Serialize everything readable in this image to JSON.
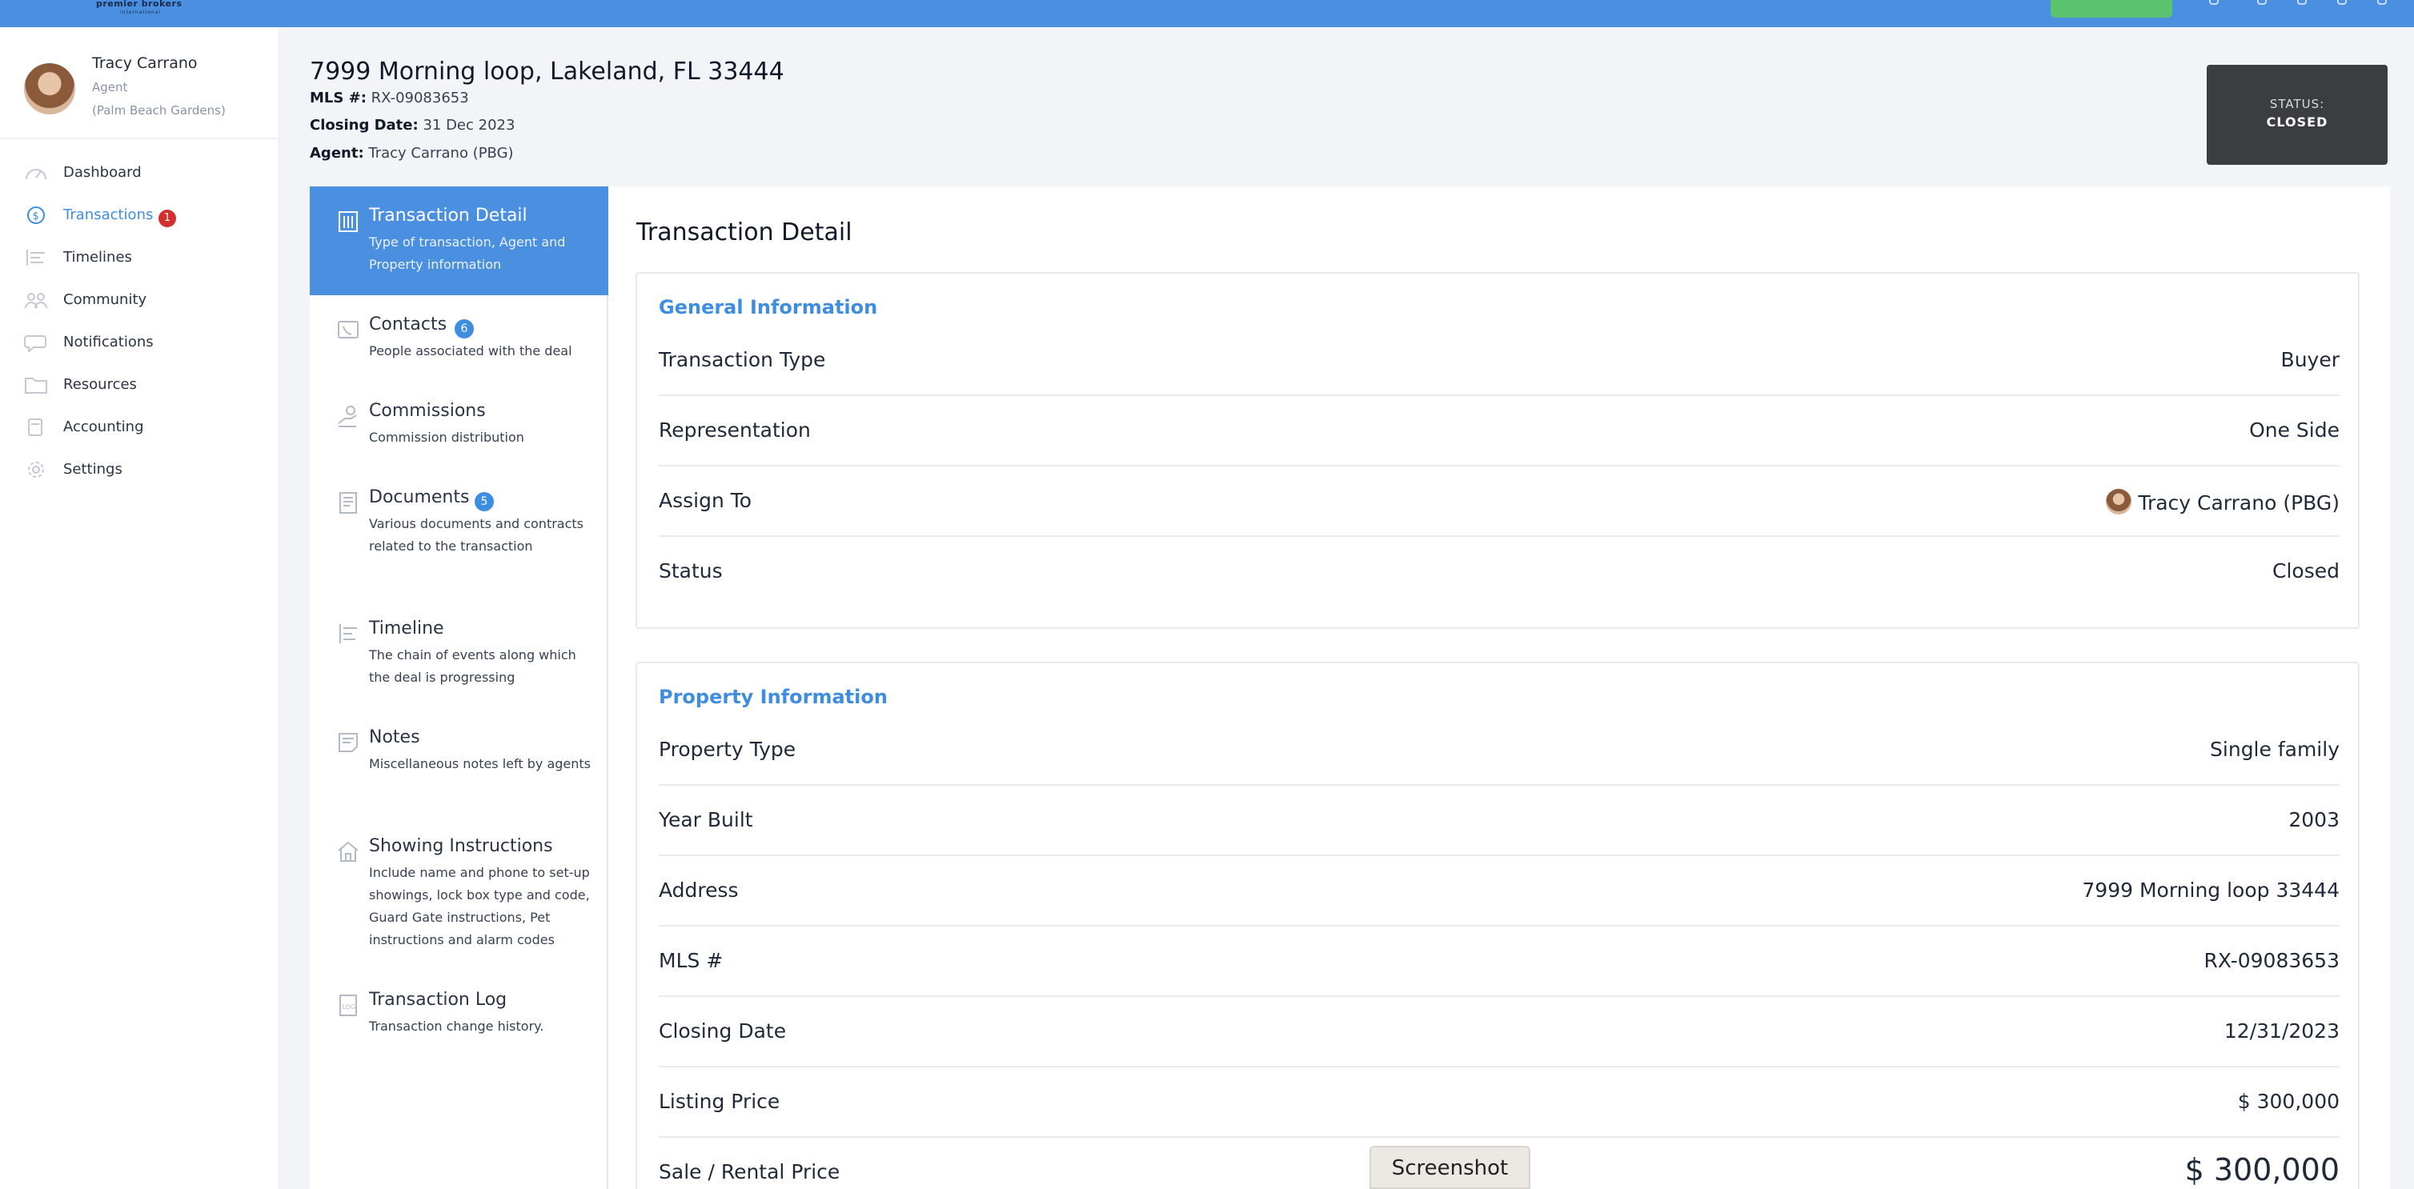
{
  "topbar": {
    "logo_line1": "premier brokers",
    "logo_line2": "international"
  },
  "user": {
    "name": "Tracy Carrano",
    "role": "Agent",
    "office": "(Palm Beach Gardens)"
  },
  "nav": {
    "items": [
      {
        "label": "Dashboard",
        "icon": "speedometer-icon"
      },
      {
        "label": "Transactions",
        "icon": "dollar-cycle-icon",
        "badge": "1",
        "active": true
      },
      {
        "label": "Timelines",
        "icon": "timeline-icon"
      },
      {
        "label": "Community",
        "icon": "people-icon"
      },
      {
        "label": "Notifications",
        "icon": "chat-bubble-icon"
      },
      {
        "label": "Resources",
        "icon": "folder-icon"
      },
      {
        "label": "Accounting",
        "icon": "calculator-icon"
      },
      {
        "label": "Settings",
        "icon": "gear-icon"
      }
    ]
  },
  "header": {
    "address": "7999 Morning loop, Lakeland, FL 33444",
    "mls_label": "MLS #:",
    "mls_value": "RX-09083653",
    "closing_label": "Closing Date:",
    "closing_value": "31 Dec 2023",
    "agent_label": "Agent:",
    "agent_value": "Tracy Carrano (PBG)",
    "status_label": "STATUS:",
    "status_value": "CLOSED"
  },
  "tabs": [
    {
      "title": "Transaction Detail",
      "desc": "Type of transaction, Agent and Property information",
      "icon": "building-icon",
      "active": true
    },
    {
      "title": "Contacts",
      "desc": "People associated with the deal",
      "icon": "phone-icon",
      "badge": "6"
    },
    {
      "title": "Commissions",
      "desc": "Commission distribution",
      "icon": "hand-money-icon"
    },
    {
      "title": "Documents",
      "desc": "Various documents and contracts related to the transaction",
      "icon": "document-icon",
      "badge": "5"
    },
    {
      "title": "Timeline",
      "desc": "The chain of events along which the deal is progressing",
      "icon": "timeline-icon"
    },
    {
      "title": "Notes",
      "desc": "Miscellaneous notes left by agents",
      "icon": "note-icon"
    },
    {
      "title": "Showing Instructions",
      "desc": "Include name and phone to set-up showings, lock box type and code, Guard Gate instructions, Pet instructions and alarm codes",
      "icon": "house-icon"
    },
    {
      "title": "Transaction Log",
      "desc": "Transaction change history.",
      "icon": "log-icon"
    }
  ],
  "main": {
    "title": "Transaction Detail",
    "general": {
      "title": "General Information",
      "rows": [
        {
          "label": "Transaction Type",
          "value": "Buyer"
        },
        {
          "label": "Representation",
          "value": "One Side"
        },
        {
          "label": "Assign To",
          "value": "Tracy Carrano (PBG)"
        },
        {
          "label": "Status",
          "value": "Closed"
        }
      ]
    },
    "property": {
      "title": "Property Information",
      "rows": [
        {
          "label": "Property Type",
          "value": "Single family"
        },
        {
          "label": "Year Built",
          "value": "2003"
        },
        {
          "label": "Address",
          "value": "7999 Morning loop 33444"
        },
        {
          "label": "MLS #",
          "value": "RX-09083653"
        },
        {
          "label": "Closing Date",
          "value": "12/31/2023"
        },
        {
          "label": "Listing Price",
          "value": "$ 300,000"
        },
        {
          "label": "Sale / Rental Price",
          "value": "$ 300,000"
        }
      ]
    }
  },
  "overlay": {
    "screenshot_label": "Screenshot"
  }
}
